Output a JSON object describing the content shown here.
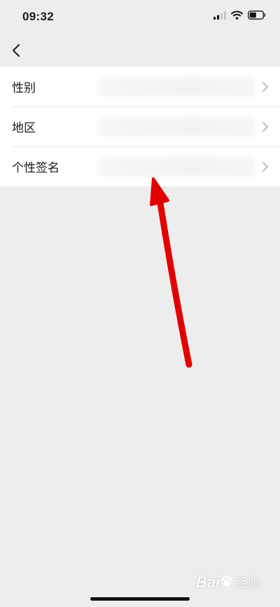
{
  "status_bar": {
    "time": "09:32",
    "icons": [
      "signal-icon",
      "wifi-icon",
      "battery-icon"
    ]
  },
  "nav": {
    "back_icon": "chevron-left-icon"
  },
  "list": {
    "items": [
      {
        "label": "性别"
      },
      {
        "label": "地区"
      },
      {
        "label": "个性签名"
      }
    ]
  },
  "annotation": {
    "color": "#e30000"
  },
  "watermark": {
    "brand": "Bai",
    "sub": "经验"
  },
  "colors": {
    "background": "#ededed",
    "list_background": "#ffffff",
    "chevron": "#b2b2b2"
  }
}
